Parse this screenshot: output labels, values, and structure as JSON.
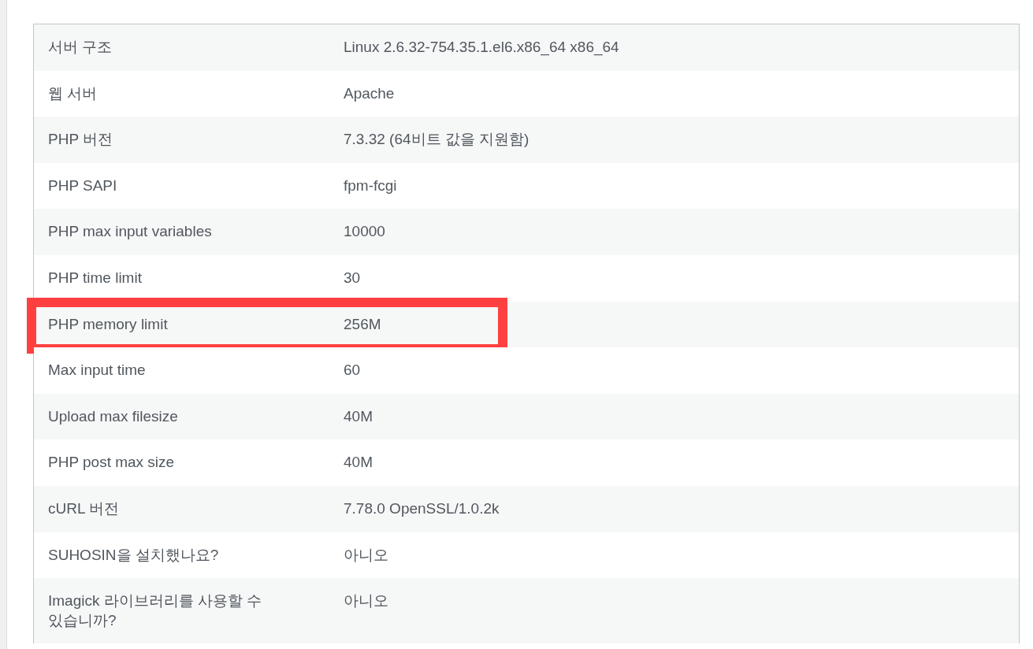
{
  "table": {
    "rows": [
      {
        "label": "서버 구조",
        "value": "Linux 2.6.32-754.35.1.el6.x86_64 x86_64",
        "highlighted": false
      },
      {
        "label": "웹 서버",
        "value": "Apache",
        "highlighted": false
      },
      {
        "label": "PHP 버전",
        "value": "7.3.32 (64비트 값을 지원함)",
        "highlighted": false
      },
      {
        "label": "PHP SAPI",
        "value": "fpm-fcgi",
        "highlighted": false
      },
      {
        "label": "PHP max input variables",
        "value": "10000",
        "highlighted": false
      },
      {
        "label": "PHP time limit",
        "value": "30",
        "highlighted": false
      },
      {
        "label": "PHP memory limit",
        "value": "256M",
        "highlighted": true
      },
      {
        "label": "Max input time",
        "value": "60",
        "highlighted": false
      },
      {
        "label": "Upload max filesize",
        "value": "40M",
        "highlighted": false
      },
      {
        "label": "PHP post max size",
        "value": "40M",
        "highlighted": false
      },
      {
        "label": "cURL 버전",
        "value": "7.78.0 OpenSSL/1.0.2k",
        "highlighted": false
      },
      {
        "label": "SUHOSIN을 설치했나요?",
        "value": "아니오",
        "highlighted": false
      },
      {
        "label": "Imagick 라이브러리를 사용할 수 있습니까?",
        "value": "아니오",
        "highlighted": false
      }
    ]
  }
}
